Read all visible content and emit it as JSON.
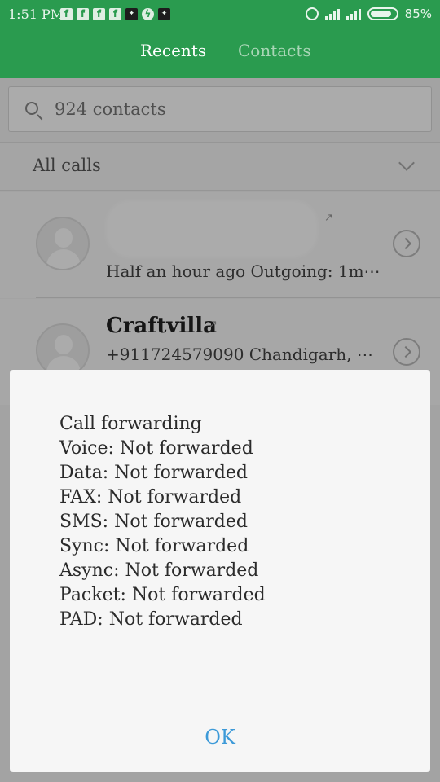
{
  "status_bar": {
    "time": "1:51 PM",
    "notification_icons": [
      "facebook-icon",
      "facebook-icon",
      "facebook-icon",
      "facebook-icon",
      "app-icon",
      "messenger-icon",
      "app-icon"
    ],
    "battery": "85%",
    "battery_level": 0.85
  },
  "tabs": {
    "recents": "Recents",
    "contacts": "Contacts"
  },
  "search": {
    "placeholder": "924 contacts"
  },
  "filter": {
    "label": "All calls"
  },
  "calls": [
    {
      "name": "",
      "subtitle": "Half an hour ago Outgoing: 1m⋯"
    },
    {
      "name": "Craftvilla",
      "subtitle": "+911724579090 Chandigarh, ⋯"
    }
  ],
  "dialog": {
    "lines": [
      "Call forwarding",
      "Voice: Not forwarded",
      "Data: Not forwarded",
      "FAX: Not forwarded",
      "SMS: Not forwarded",
      "Sync: Not forwarded",
      "Async: Not forwarded",
      "Packet: Not forwarded",
      "PAD: Not forwarded"
    ],
    "ok_label": "OK"
  },
  "colors": {
    "header": "#2a9b4f",
    "accent_button": "#3d9ad8"
  }
}
